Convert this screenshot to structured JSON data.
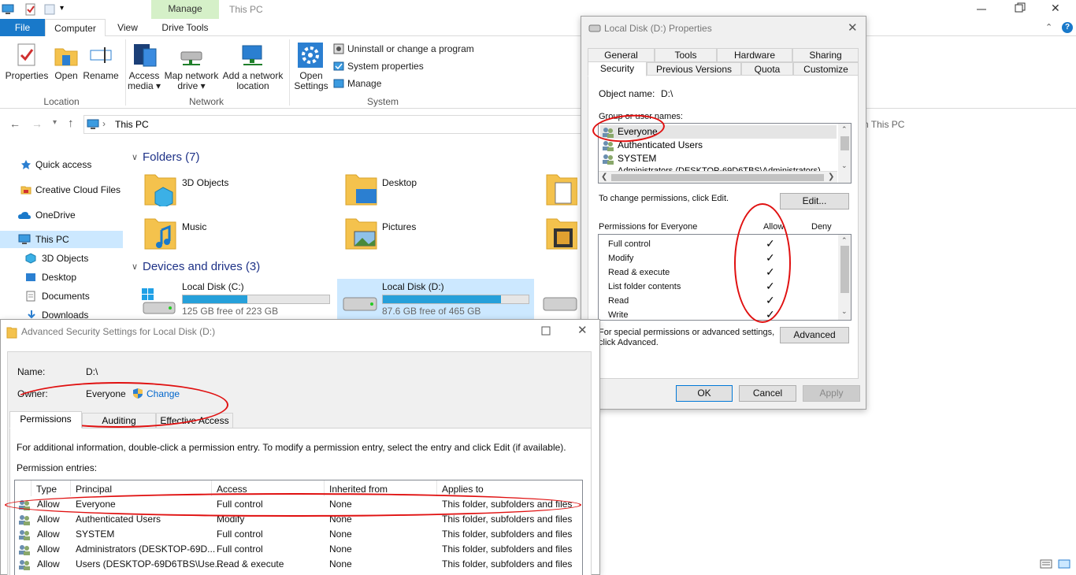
{
  "explorer": {
    "contextual_tab": "Manage",
    "window_title": "This PC",
    "tabs": [
      "File",
      "Computer",
      "View",
      "Drive Tools"
    ],
    "ribbon": {
      "location": {
        "group": "Location",
        "buttons": [
          "Properties",
          "Open",
          "Rename"
        ]
      },
      "network": {
        "group": "Network",
        "access_media_1": "Access",
        "access_media_2": "media ▾",
        "map_drive_1": "Map network",
        "map_drive_2": "drive ▾",
        "add_loc_1": "Add a network",
        "add_loc_2": "location"
      },
      "system": {
        "group": "System",
        "open_settings_1": "Open",
        "open_settings_2": "Settings",
        "small": [
          "Uninstall or change a program",
          "System properties",
          "Manage"
        ]
      }
    },
    "address": "This PC",
    "search_placeholder": "h This PC",
    "nav": [
      "Quick access",
      "Creative Cloud Files",
      "OneDrive",
      "This PC",
      "3D Objects",
      "Desktop",
      "Documents",
      "Downloads"
    ],
    "folders_header": "Folders (7)",
    "folders": [
      "3D Objects",
      "Desktop",
      "Music",
      "Pictures"
    ],
    "drives_header": "Devices and drives (3)",
    "drives": [
      {
        "name": "Local Disk (C:)",
        "free": "125 GB free of 223 GB",
        "used_fraction": 0.44
      },
      {
        "name": "Local Disk (D:)",
        "free": "87.6 GB free of 465 GB",
        "used_fraction": 0.81
      }
    ]
  },
  "props": {
    "title": "Local Disk (D:) Properties",
    "tabs_row1": [
      "General",
      "Tools",
      "Hardware",
      "Sharing"
    ],
    "tabs_row2": [
      "Security",
      "Previous Versions",
      "Quota",
      "Customize"
    ],
    "object_label": "Object name:",
    "object_value": "D:\\",
    "group_label": "Group or user names:",
    "users": [
      "Everyone",
      "Authenticated Users",
      "SYSTEM",
      "Administrators (DESKTOP-69D6TBS\\Administrators)"
    ],
    "change_text": "To change permissions, click Edit.",
    "edit_button": "Edit...",
    "perm_label": "Permissions for Everyone",
    "allow": "Allow",
    "deny": "Deny",
    "permissions": [
      "Full control",
      "Modify",
      "Read & execute",
      "List folder contents",
      "Read",
      "Write"
    ],
    "special_1": "For special permissions or advanced settings,",
    "special_2": "click Advanced.",
    "advanced_button": "Advanced",
    "ok": "OK",
    "cancel": "Cancel",
    "apply": "Apply"
  },
  "adv": {
    "title": "Advanced Security Settings for Local Disk (D:)",
    "name_label": "Name:",
    "name_value": "D:\\",
    "owner_label": "Owner:",
    "owner_value": "Everyone",
    "change_link": "Change",
    "tabs": [
      "Permissions",
      "Auditing",
      "Effective Access"
    ],
    "info": "For additional information, double-click a permission entry. To modify a permission entry, select the entry and click Edit (if available).",
    "entries_label": "Permission entries:",
    "columns": [
      "Type",
      "Principal",
      "Access",
      "Inherited from",
      "Applies to"
    ],
    "rows": [
      [
        "Allow",
        "Everyone",
        "Full control",
        "None",
        "This folder, subfolders and files"
      ],
      [
        "Allow",
        "Authenticated Users",
        "Modify",
        "None",
        "This folder, subfolders and files"
      ],
      [
        "Allow",
        "SYSTEM",
        "Full control",
        "None",
        "This folder, subfolders and files"
      ],
      [
        "Allow",
        "Administrators (DESKTOP-69D...",
        "Full control",
        "None",
        "This folder, subfolders and files"
      ],
      [
        "Allow",
        "Users (DESKTOP-69D6TBS\\Use...",
        "Read & execute",
        "None",
        "This folder, subfolders and files"
      ]
    ]
  },
  "colors": {
    "accent": "#1979ca",
    "selection": "#cce8ff",
    "annotation": "#e01010",
    "drive_fill": "#26a0da"
  }
}
